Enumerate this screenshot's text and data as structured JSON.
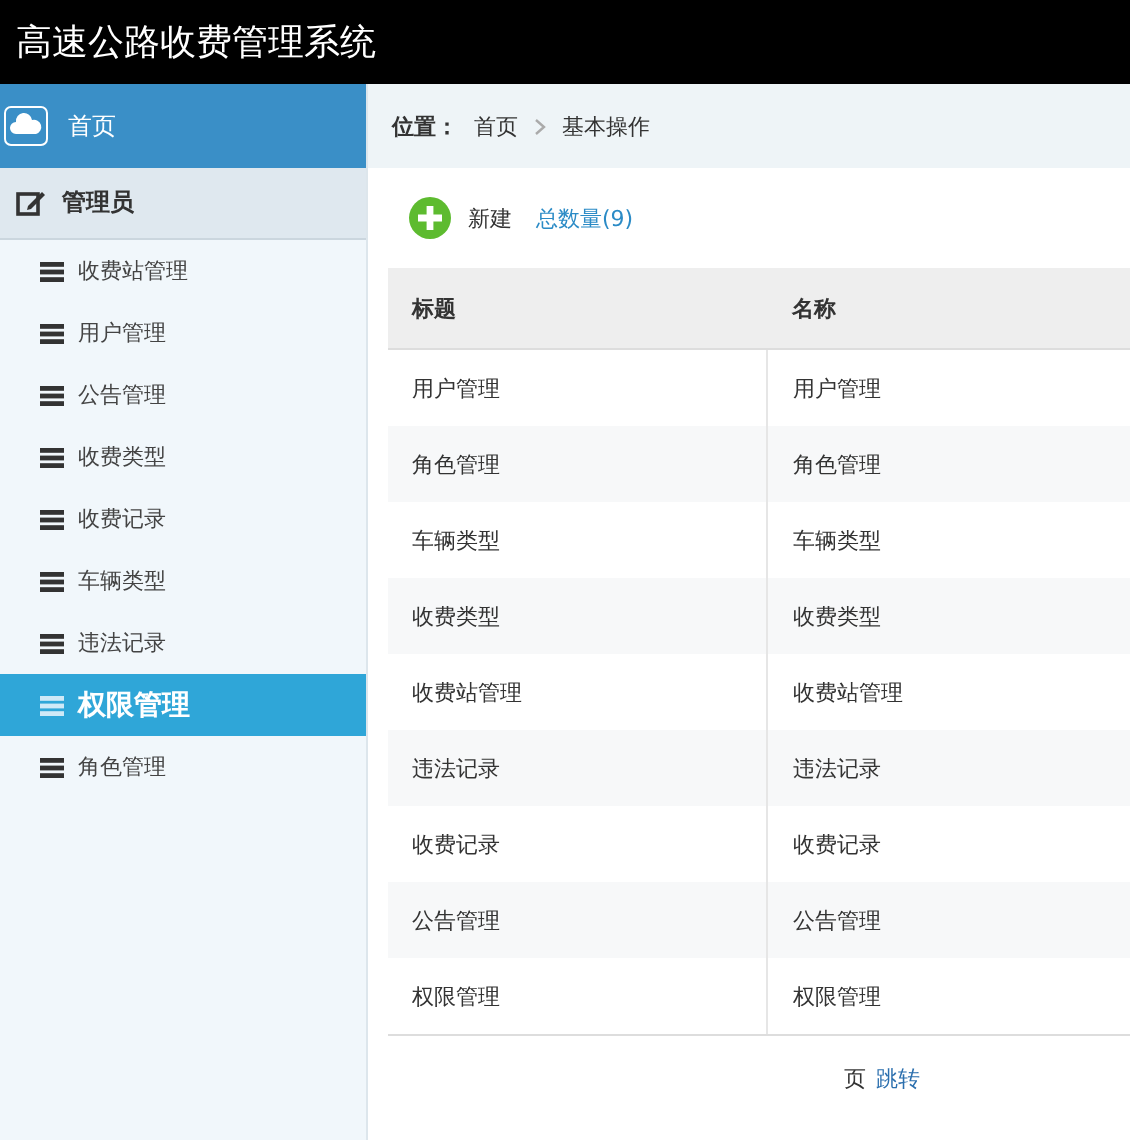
{
  "window": {
    "title": "高速公路收费管理系统"
  },
  "sidebar": {
    "home": "首页",
    "group": "管理员",
    "items": [
      {
        "label": "收费站管理",
        "selected": false
      },
      {
        "label": "用户管理",
        "selected": false
      },
      {
        "label": "公告管理",
        "selected": false
      },
      {
        "label": "收费类型",
        "selected": false
      },
      {
        "label": "收费记录",
        "selected": false
      },
      {
        "label": "车辆类型",
        "selected": false
      },
      {
        "label": "违法记录",
        "selected": false
      },
      {
        "label": "权限管理",
        "selected": true
      },
      {
        "label": "角色管理",
        "selected": false
      }
    ]
  },
  "breadcrumb": {
    "label": "位置：",
    "items": [
      "首页",
      "基本操作"
    ]
  },
  "toolbar": {
    "new": "新建",
    "count": "总数量(9)"
  },
  "table": {
    "columns": [
      "标题",
      "名称"
    ],
    "rows": [
      [
        "用户管理",
        "用户管理"
      ],
      [
        "角色管理",
        "角色管理"
      ],
      [
        "车辆类型",
        "车辆类型"
      ],
      [
        "收费类型",
        "收费类型"
      ],
      [
        "收费站管理",
        "收费站管理"
      ],
      [
        "违法记录",
        "违法记录"
      ],
      [
        "收费记录",
        "收费记录"
      ],
      [
        "公告管理",
        "公告管理"
      ],
      [
        "权限管理",
        "权限管理"
      ]
    ]
  },
  "pagination": {
    "page_unit": "页",
    "jump": "跳转"
  }
}
